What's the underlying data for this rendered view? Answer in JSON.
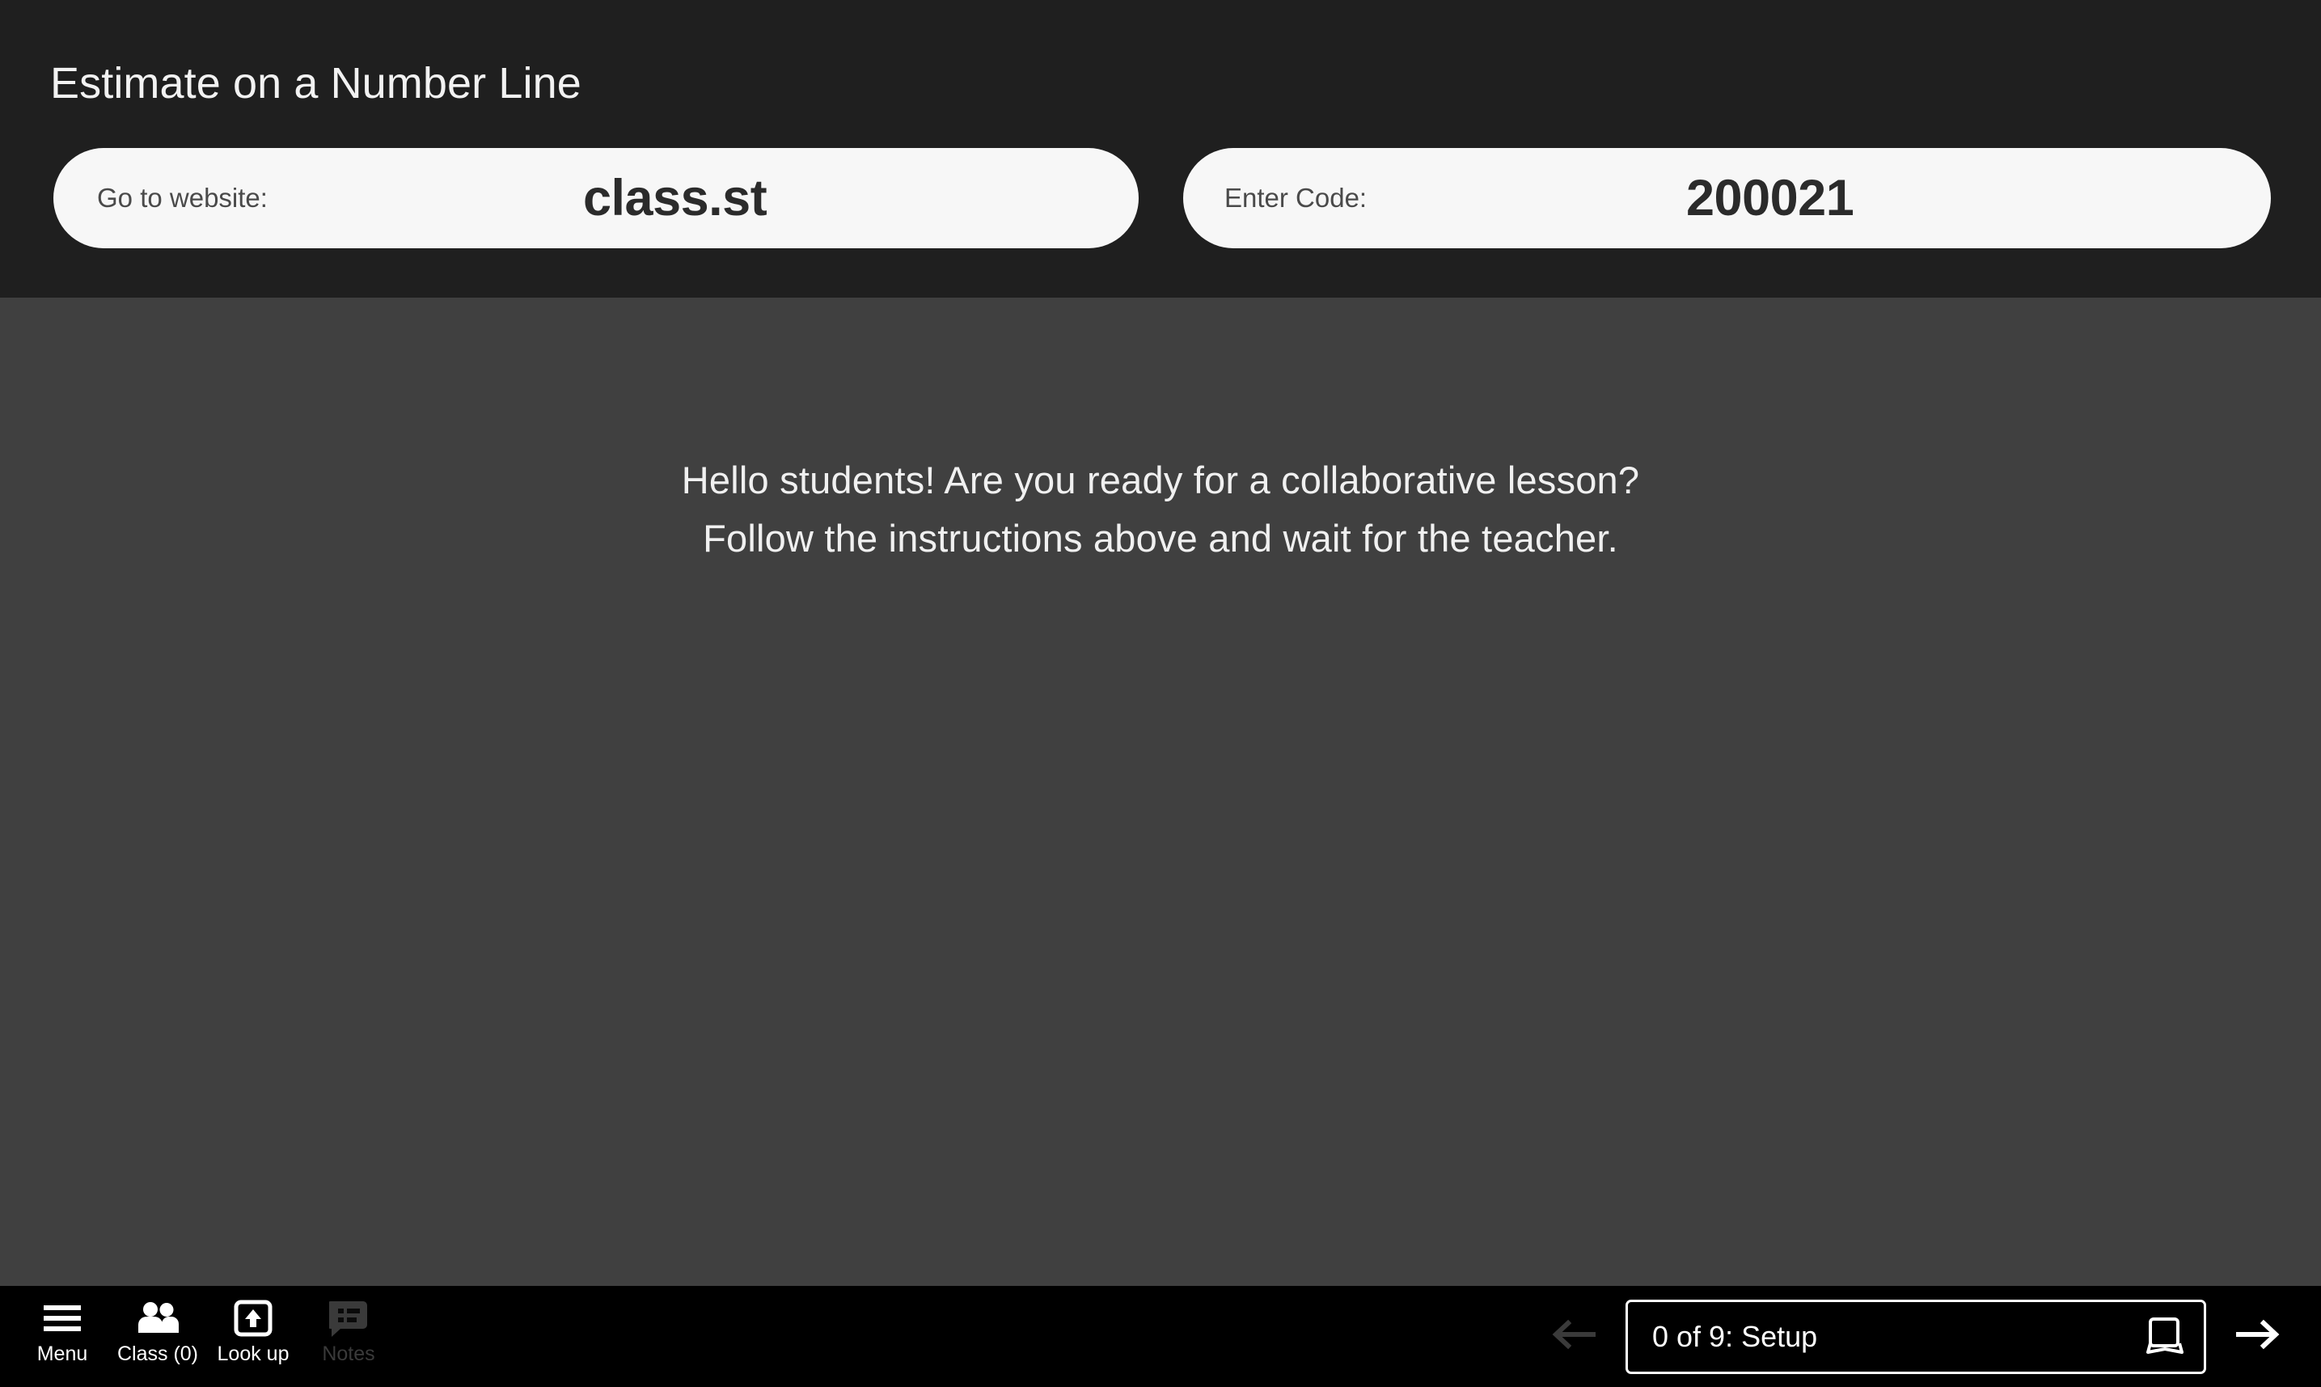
{
  "header": {
    "title": "Estimate on a Number Line",
    "website_pill": {
      "label": "Go to website:",
      "value": "class.st",
      "name": "website-pill"
    },
    "code_pill": {
      "label": "Enter Code:",
      "value": "200021",
      "name": "code-pill"
    },
    "background_color": "#1f1f1f",
    "pill_color": "#f7f7f7"
  },
  "stage": {
    "message_line_1": "Hello students! Are you ready for a collaborative lesson?",
    "message_line_2": "Follow the instructions above and wait for the teacher.",
    "background_color": "#404040",
    "text_color": "#f0f0f0"
  },
  "bottombar": {
    "background_color": "#000000",
    "tools": [
      {
        "label": "Menu",
        "icon": "hamburger-menu-icon",
        "enabled": true
      },
      {
        "label": "Class (0)",
        "icon": "people-icon",
        "enabled": true
      },
      {
        "label": "Look up",
        "icon": "upload-box-icon",
        "enabled": true
      },
      {
        "label": "Notes",
        "icon": "notes-bubble-icon",
        "enabled": false
      }
    ],
    "nav": {
      "prev_icon": "arrow-left-icon",
      "prev_enabled": false,
      "next_icon": "arrow-right-icon",
      "next_enabled": true,
      "slide_label": "0 of 9: Setup",
      "slide_icon": "flipchart-book-icon",
      "current_slide": 0,
      "total_slides": 9,
      "slide_name": "Setup",
      "enabled_arrow_color": "#ffffff",
      "disabled_arrow_color": "#3a3a3a"
    }
  }
}
